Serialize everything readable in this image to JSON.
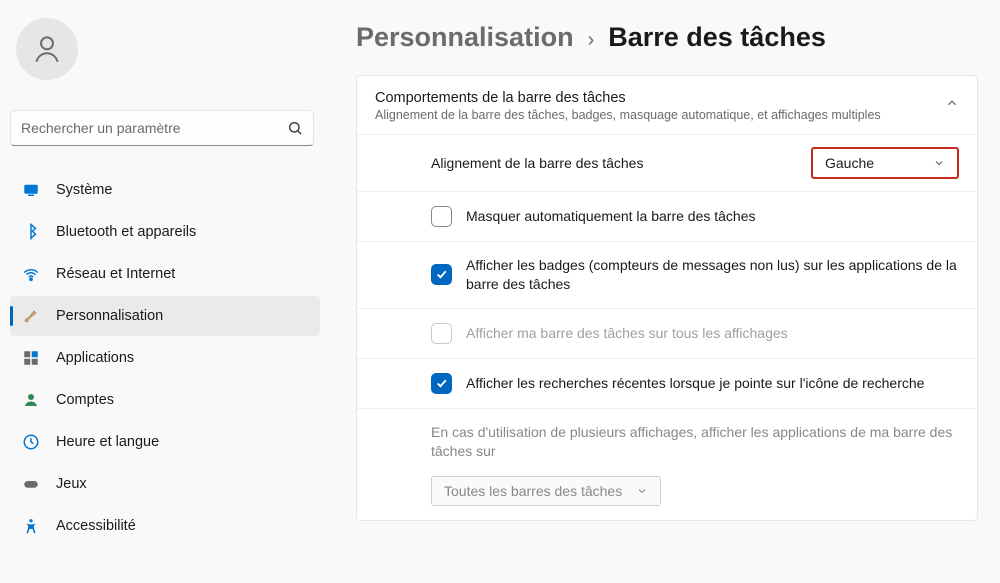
{
  "search": {
    "placeholder": "Rechercher un paramètre"
  },
  "nav": {
    "system": "Système",
    "bluetooth": "Bluetooth et appareils",
    "network": "Réseau et Internet",
    "personalization": "Personnalisation",
    "apps": "Applications",
    "accounts": "Comptes",
    "time": "Heure et langue",
    "gaming": "Jeux",
    "accessibility": "Accessibilité"
  },
  "breadcrumb": {
    "parent": "Personnalisation",
    "sep": "›",
    "current": "Barre des tâches"
  },
  "panel": {
    "title": "Comportements de la barre des tâches",
    "subtitle": "Alignement de la barre des tâches, badges, masquage automatique, et affichages multiples"
  },
  "settings": {
    "alignment": {
      "label": "Alignement de la barre des tâches",
      "value": "Gauche"
    },
    "autohide": {
      "label": "Masquer automatiquement la barre des tâches"
    },
    "badges": {
      "label": "Afficher les badges (compteurs de messages non lus) sur les applications de la barre des tâches"
    },
    "multidisplay": {
      "label": "Afficher ma barre des tâches sur tous les affichages"
    },
    "recent": {
      "label": "Afficher les recherches récentes lorsque je pointe sur l'icône de recherche"
    },
    "multimon": {
      "label": "En cas d'utilisation de plusieurs affichages, afficher les applications de ma barre des tâches sur",
      "value": "Toutes les barres des tâches"
    }
  }
}
